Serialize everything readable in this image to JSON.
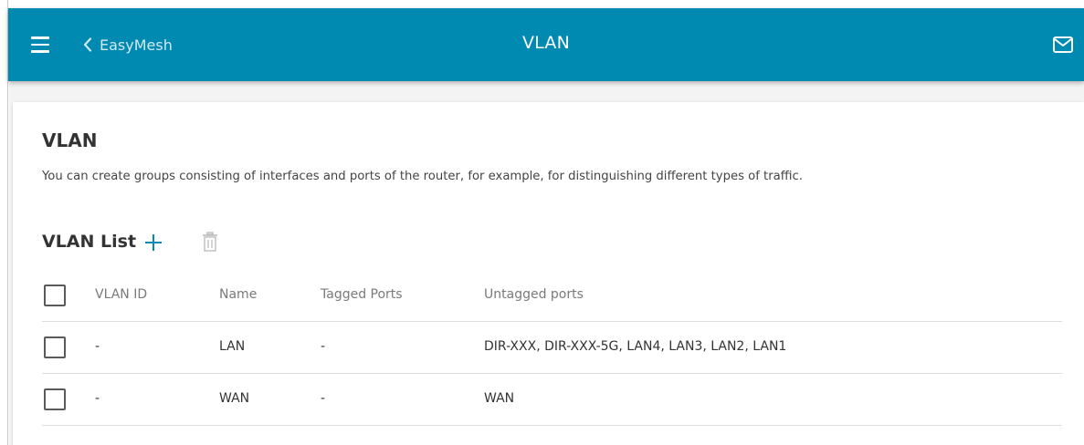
{
  "header": {
    "back_label": "EasyMesh",
    "title": "VLAN",
    "color": "#0089b1"
  },
  "section": {
    "title": "VLAN",
    "description": "You can create groups consisting of interfaces and ports of the router, for example, for distinguishing different types of traffic."
  },
  "vlan_list": {
    "title": "VLAN List",
    "columns": {
      "id": "VLAN ID",
      "name": "Name",
      "tagged": "Tagged Ports",
      "untagged": "Untagged ports"
    },
    "rows": [
      {
        "id": "-",
        "name": "LAN",
        "tagged": "-",
        "untagged": "DIR-XXX, DIR-XXX-5G, LAN4, LAN3, LAN2, LAN1"
      },
      {
        "id": "-",
        "name": "WAN",
        "tagged": "-",
        "untagged": "WAN"
      }
    ]
  },
  "icons": {
    "menu": "hamburger-menu-icon",
    "back": "chevron-left-icon",
    "mail": "envelope-icon",
    "add": "plus-icon",
    "delete": "trash-icon"
  }
}
